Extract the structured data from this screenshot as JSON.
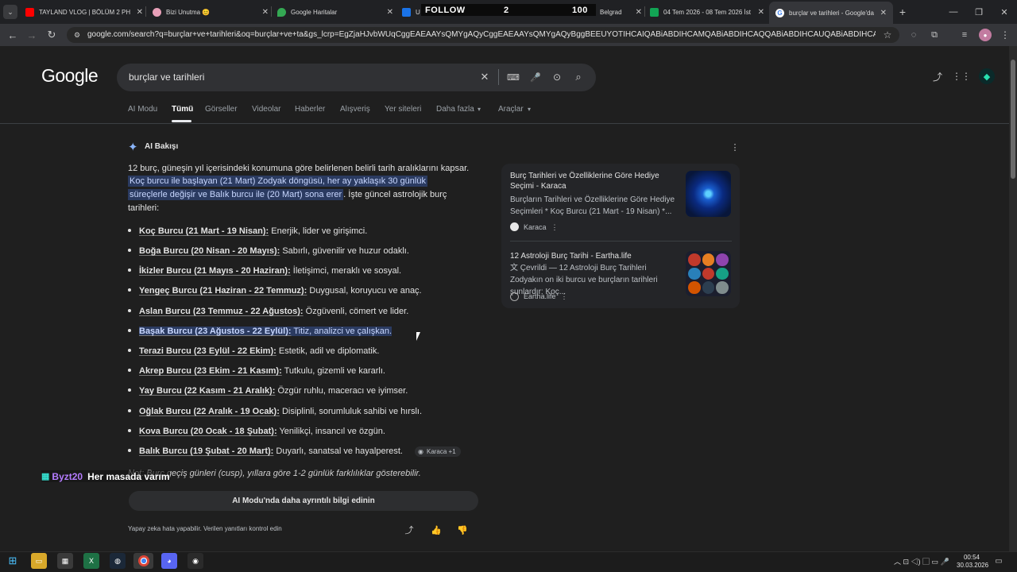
{
  "tabs": [
    {
      "title": "TAYLAND VLOG | BÖLÜM 2 PH",
      "color": "#ff0000"
    },
    {
      "title": "Bizi Unutma 😊",
      "color": "#e8a0b8"
    },
    {
      "title": "Google Haritalar",
      "color": "#34a853"
    },
    {
      "title": "U",
      "color": "#1a73e8"
    },
    {
      "title": "Belgrad",
      "color": "#555"
    },
    {
      "title": "04 Tem 2026 - 08 Tem 2026 İst",
      "color": "#12a454"
    },
    {
      "title": "burçlar ve tarihleri - Google'da",
      "color": "#ffffff"
    }
  ],
  "overlay": {
    "follow": "FOLLOW",
    "count": "2",
    "target": "100"
  },
  "url": "google.com/search?q=burçlar+ve+tarihleri&oq=burçlar+ve+ta&gs_lcrp=EgZjaHJvbWUqCggEAEAAYsQMYgAQyCggEAEAAYsQMYgAQyBggBEEUYOTIHCAIQABiABDIHCAMQABiABDIHCAQQABiABDIHCAUQABiABDIHCAYQABiABDIH...",
  "google": {
    "logo": "Google",
    "query": "burçlar ve tarihleri"
  },
  "nav": [
    "AI Modu",
    "Tümü",
    "Görseller",
    "Videolar",
    "Haberler",
    "Alışveriş",
    "Yer siteleri",
    "Daha fazla",
    "Araçlar"
  ],
  "ai": {
    "heading": "AI Bakışı",
    "intro1": "12 burç, güneşin yıl içerisindeki konumuna göre belirlenen belirli tarih aralıklarını kapsar.",
    "hl1": "Koç burcu ile başlayan (21 Mart) Zodyak döngüsü, her ay yaklaşık 30 günlük",
    "hl2": "süreçlerle değişir ve Balık burcu ile (20 Mart) sona erer",
    "intro2": ". İşte güncel astrolojik burç",
    "intro3": "tarihleri:",
    "items": [
      {
        "bold": "Koç Burcu (21 Mart - 19 Nisan):",
        "text": " Enerjik, lider ve girişimci."
      },
      {
        "bold": "Boğa Burcu (20 Nisan - 20 Mayıs):",
        "text": " Sabırlı, güvenilir ve huzur odaklı."
      },
      {
        "bold": "İkizler Burcu (21 Mayıs - 20 Haziran):",
        "text": " İletişimci, meraklı ve sosyal."
      },
      {
        "bold": "Yengeç Burcu (21 Haziran - 22 Temmuz):",
        "text": " Duygusal, koruyucu ve anaç."
      },
      {
        "bold": "Aslan Burcu (23 Temmuz - 22 Ağustos):",
        "text": " Özgüvenli, cömert ve lider."
      },
      {
        "bold": "Başak Burcu (23 Ağustos - 22 Eylül):",
        "text": " Titiz, analizci ve çalışkan."
      },
      {
        "bold": "Terazi Burcu (23 Eylül - 22 Ekim):",
        "text": " Estetik, adil ve diplomatik."
      },
      {
        "bold": "Akrep Burcu (23 Ekim - 21 Kasım):",
        "text": " Tutkulu, gizemli ve kararlı."
      },
      {
        "bold": "Yay Burcu (22 Kasım - 21 Aralık):",
        "text": " Özgür ruhlu, maceracı ve iyimser."
      },
      {
        "bold": "Oğlak Burcu (22 Aralık - 19 Ocak):",
        "text": " Disiplinli, sorumluluk sahibi ve hırslı."
      },
      {
        "bold": "Kova Burcu (20 Ocak - 18 Şubat):",
        "text": " Yenilikçi, insancıl ve özgün."
      },
      {
        "bold": "Balık Burcu (19 Şubat - 20 Mart):",
        "text": " Duyarlı, sanatsal ve hayalperest."
      }
    ],
    "chip": "Karaca +1",
    "note": "Not: Burç geçiş günleri (cusp), yıllara göre 1-2 günlük farklılıklar gösterebilir.",
    "more_button": "AI Modu'nda daha ayrıntılı bilgi edinin",
    "disclaimer": "Yapay zeka hata yapabilir. Verilen yanıtları kontrol edin"
  },
  "streamer": {
    "name": "Byzt20",
    "message": "Her masada varım"
  },
  "sources": [
    {
      "title": "Burç Tarihleri ve Özelliklerine Göre Hediye Seçimi - Karaca",
      "snippet": "Burçların Tarihleri ve Özelliklerine Göre Hediye Seçimleri * Koç Burcu (21 Mart - 19 Nisan) *...",
      "site": "Karaca"
    },
    {
      "title": "12 Astroloji Burç Tarihi - Eartha.life",
      "snippet": "文 Çevrildi — 12 Astroloji Burç Tarihleri Zodyakın on iki burcu ve burçların tarihleri şunlardır: Koç...",
      "site": "Eartha.life"
    }
  ],
  "clock": {
    "time": "00:54",
    "date": "30.03.2026"
  }
}
